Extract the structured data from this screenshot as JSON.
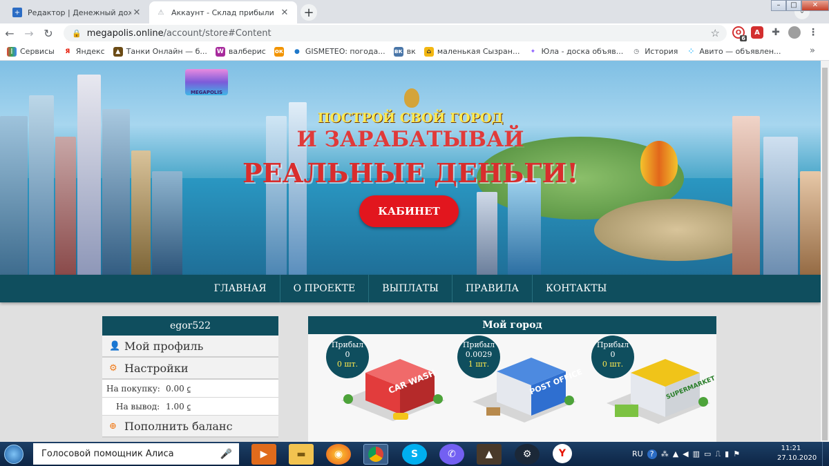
{
  "browser": {
    "tabs": [
      {
        "title": "Редактор | Денежный дождь!:) |",
        "close": "✕",
        "favicon_color": "#2b6cc4"
      },
      {
        "title": "Аккаунт - Склад прибыли",
        "close": "✕",
        "favicon_color": "#c9c9c9"
      }
    ],
    "new_tab": "+",
    "url": {
      "host": "megapolis.online",
      "path": "/account/store#Content"
    },
    "window": {
      "min": "–",
      "max": "□",
      "close": "✕"
    },
    "bookmarks": [
      {
        "label": "Сервисы",
        "icon": "grid-icon",
        "color": "#e94235"
      },
      {
        "label": "Яндекс",
        "icon": "Я",
        "color": "#ffffff"
      },
      {
        "label": "Танки Онлайн — б...",
        "icon": "tank-icon",
        "color": "#6b4b15"
      },
      {
        "label": "валберис",
        "icon": "W",
        "color": "#a72a9c"
      },
      {
        "label": "",
        "icon": "ok-icon",
        "color": "#f29400"
      },
      {
        "label": "GISMETEO: погода...",
        "icon": "drop-icon",
        "color": "#1f78c9"
      },
      {
        "label": "вк",
        "icon": "vk-icon",
        "color": "#4a76a8"
      },
      {
        "label": "маленькая Сызран...",
        "icon": "city-icon",
        "color": "#f3b711"
      },
      {
        "label": "Юла - доска объяв...",
        "icon": "star4-icon",
        "color": "#8a5cff"
      },
      {
        "label": "История",
        "icon": "history-icon",
        "color": "#5f6368"
      },
      {
        "label": "Авито — объявлен...",
        "icon": "avito-icon",
        "color": "#00aaff"
      }
    ],
    "bookmarks_more": "»",
    "ext_badge": "6"
  },
  "site": {
    "logo": "MEGAPOLIS",
    "headline1": "ПОСТРОЙ СВОЙ ГОРОД",
    "headline2": "И ЗАРАБАТЫВАЙ",
    "headline3": "РЕАЛЬНЫЕ ДЕНЬГИ!",
    "cabinet": "КАБИНЕТ",
    "nav": [
      "ГЛАВНАЯ",
      "О ПРОЕКТЕ",
      "ВЫПЛАТЫ",
      "ПРАВИЛА",
      "КОНТАКТЫ"
    ],
    "user": {
      "name": "egor522",
      "profile": "Мой профиль",
      "settings": "Настройки",
      "buy_label": "На покупку:",
      "buy_value": "0.00 ⃀",
      "withdraw_label": "На вывод:",
      "withdraw_value": "1.00 ⃀",
      "topup": "Пополнить баланс"
    },
    "city": {
      "title": "Мой город",
      "buildings": [
        {
          "label": "Прибыл",
          "profit": "0",
          "count": "0 шт.",
          "sign": "CAR WASH",
          "color": "#e23c3c"
        },
        {
          "label": "Прибыл",
          "profit": "0.0029",
          "count": "1 шт.",
          "sign": "POST OFFICE",
          "color": "#2f6fd0"
        },
        {
          "label": "Прибыл",
          "profit": "0",
          "count": "0 шт.",
          "sign": "SUPERMARKET",
          "color": "#f0c419"
        }
      ]
    }
  },
  "taskbar": {
    "search": "Голосовой помощник Алиса",
    "lang": "RU",
    "time": "11:21",
    "date": "27.10.2020"
  }
}
